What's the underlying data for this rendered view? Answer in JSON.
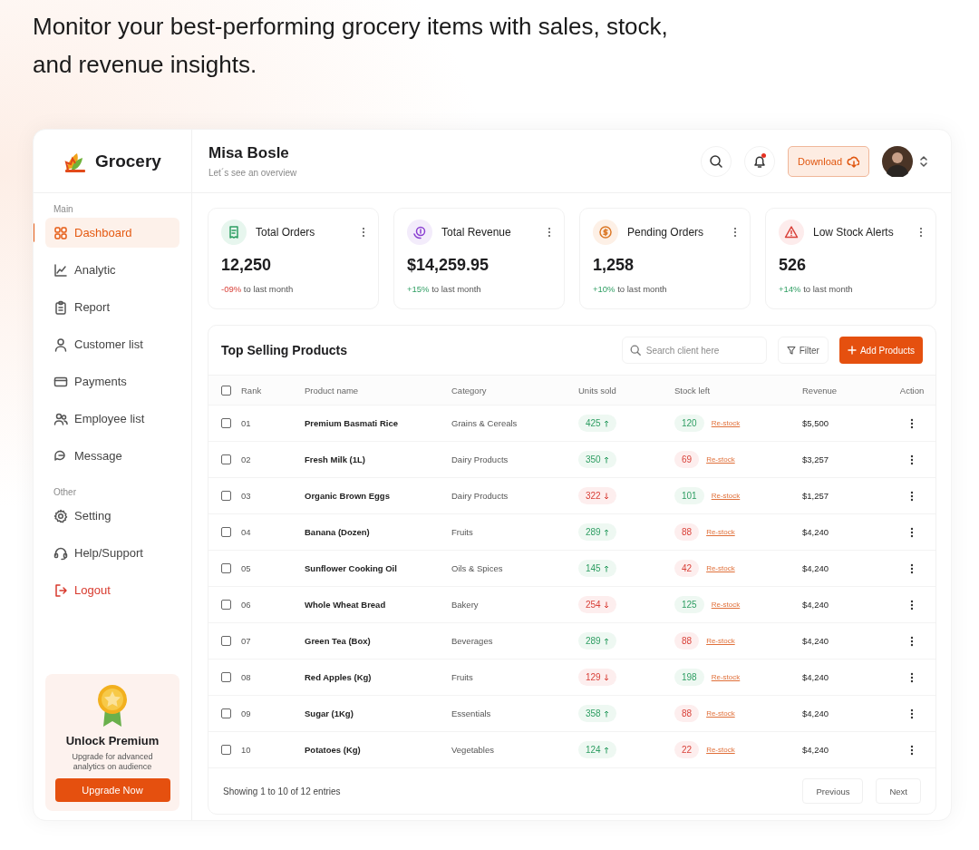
{
  "headline": "Monitor your best-performing grocery items with sales, stock, and revenue insights.",
  "sidebar": {
    "brand": "Grocery",
    "sections": [
      {
        "title": "Main",
        "items": [
          {
            "label": "Dashboard",
            "selected": true,
            "kind": "normal"
          },
          {
            "label": "Analytic",
            "selected": false,
            "kind": "normal"
          },
          {
            "label": "Report",
            "selected": false,
            "kind": "normal"
          },
          {
            "label": "Customer list",
            "selected": false,
            "kind": "normal"
          },
          {
            "label": "Payments",
            "selected": false,
            "kind": "normal"
          },
          {
            "label": "Employee list",
            "selected": false,
            "kind": "normal"
          },
          {
            "label": "Message",
            "selected": false,
            "kind": "normal"
          }
        ]
      },
      {
        "title": "Other",
        "items": [
          {
            "label": "Setting",
            "selected": false,
            "kind": "normal"
          },
          {
            "label": "Help/Support",
            "selected": false,
            "kind": "normal"
          },
          {
            "label": "Logout",
            "selected": false,
            "kind": "danger"
          }
        ]
      }
    ],
    "promo": {
      "title": "Unlock Premium",
      "text": "Upgrade for advanced analytics on audience",
      "button": "Upgrade Now"
    }
  },
  "header": {
    "name": "Misa Bosle",
    "subtitle": "Let´s see an overview",
    "notification": true,
    "download": "Download"
  },
  "stats": [
    {
      "title": "Total Orders",
      "value": "12,250",
      "change": "-09%",
      "rising": false,
      "suffix": "to last month"
    },
    {
      "title": "Total Revenue",
      "value": "$14,259.95",
      "change": "+15%",
      "rising": true,
      "suffix": "to last month"
    },
    {
      "title": "Pending Orders",
      "value": "1,258",
      "change": "+10%",
      "rising": true,
      "suffix": "to last month"
    },
    {
      "title": "Low Stock Alerts",
      "value": "526",
      "change": "+14%",
      "rising": true,
      "suffix": "to last month"
    }
  ],
  "table": {
    "title": "Top Selling Products",
    "search_placeholder": "Search client here",
    "filter": "Filter",
    "add": "Add Products",
    "all_checked": false,
    "columns": [
      "Rank",
      "Product name",
      "Category",
      "Units sold",
      "Stock left",
      "Revenue",
      "Action"
    ],
    "rows": [
      {
        "checked": false,
        "rank": "01",
        "product": "Premium Basmati Rice",
        "category": "Grains & Cereals",
        "units": "425",
        "units_rising": true,
        "stock": "120",
        "low_stock": false,
        "restock": "Re-stock",
        "revenue": "$5,500"
      },
      {
        "checked": false,
        "rank": "02",
        "product": "Fresh Milk (1L)",
        "category": "Dairy Products",
        "units": "350",
        "units_rising": true,
        "stock": "69",
        "low_stock": true,
        "restock": "Re-stock",
        "revenue": "$3,257"
      },
      {
        "checked": false,
        "rank": "03",
        "product": "Organic Brown Eggs",
        "category": "Dairy Products",
        "units": "322",
        "units_rising": false,
        "stock": "101",
        "low_stock": false,
        "restock": "Re-stock",
        "revenue": "$1,257"
      },
      {
        "checked": false,
        "rank": "04",
        "product": "Banana (Dozen)",
        "category": "Fruits",
        "units": "289",
        "units_rising": true,
        "stock": "88",
        "low_stock": true,
        "restock": "Re-stock",
        "revenue": "$4,240"
      },
      {
        "checked": false,
        "rank": "05",
        "product": "Sunflower Cooking Oil",
        "category": "Oils & Spices",
        "units": "145",
        "units_rising": true,
        "stock": "42",
        "low_stock": true,
        "restock": "Re-stock",
        "revenue": "$4,240"
      },
      {
        "checked": false,
        "rank": "06",
        "product": "Whole Wheat Bread",
        "category": "Bakery",
        "units": "254",
        "units_rising": false,
        "stock": "125",
        "low_stock": false,
        "restock": "Re-stock",
        "revenue": "$4,240"
      },
      {
        "checked": false,
        "rank": "07",
        "product": "Green Tea (Box)",
        "category": "Beverages",
        "units": "289",
        "units_rising": true,
        "stock": "88",
        "low_stock": true,
        "restock": "Re-stock",
        "revenue": "$4,240"
      },
      {
        "checked": false,
        "rank": "08",
        "product": "Red Apples (Kg)",
        "category": "Fruits",
        "units": "129",
        "units_rising": false,
        "stock": "198",
        "low_stock": false,
        "restock": "Re-stock",
        "revenue": "$4,240"
      },
      {
        "checked": false,
        "rank": "09",
        "product": "Sugar (1Kg)",
        "category": "Essentials",
        "units": "358",
        "units_rising": true,
        "stock": "88",
        "low_stock": true,
        "restock": "Re-stock",
        "revenue": "$4,240"
      },
      {
        "checked": false,
        "rank": "10",
        "product": "Potatoes (Kg)",
        "category": "Vegetables",
        "units": "124",
        "units_rising": true,
        "stock": "22",
        "low_stock": true,
        "restock": "Re-stock",
        "revenue": "$4,240"
      }
    ],
    "footer": "Showing 1 to 10 of 12 entries",
    "previous": "Previous",
    "next": "Next"
  }
}
